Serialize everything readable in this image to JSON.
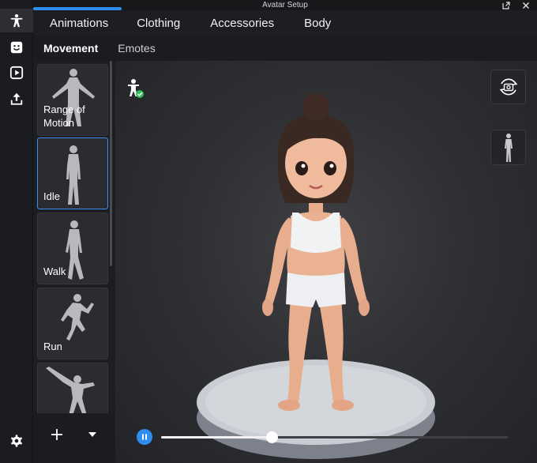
{
  "window": {
    "title": "Avatar Setup"
  },
  "rail": {
    "items": [
      {
        "icon": "person-icon",
        "active": true
      },
      {
        "icon": "smiley-icon",
        "active": false
      },
      {
        "icon": "play-icon",
        "active": false
      },
      {
        "icon": "upload-icon",
        "active": false
      }
    ],
    "settings_icon": "gear-icon"
  },
  "main_tabs": [
    {
      "label": "Animations",
      "active": true
    },
    {
      "label": "Clothing",
      "active": false
    },
    {
      "label": "Accessories",
      "active": false
    },
    {
      "label": "Body",
      "active": false
    }
  ],
  "sub_tabs": [
    {
      "label": "Movement",
      "active": true
    },
    {
      "label": "Emotes",
      "active": false
    }
  ],
  "animations": [
    {
      "label_line1": "Range of",
      "label_line2": "Motion",
      "selected": false
    },
    {
      "label_line1": "Idle",
      "label_line2": "",
      "selected": true
    },
    {
      "label_line1": "Walk",
      "label_line2": "",
      "selected": false
    },
    {
      "label_line1": "Run",
      "label_line2": "",
      "selected": false
    },
    {
      "label_line1": "",
      "label_line2": "",
      "selected": false
    }
  ],
  "playback": {
    "state": "playing",
    "progress": 0.32
  },
  "colors": {
    "accent": "#2f8df0",
    "success": "#2fbf5a"
  }
}
